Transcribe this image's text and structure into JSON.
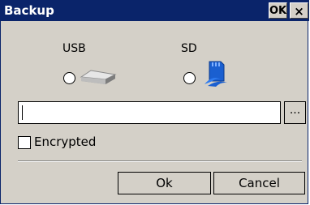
{
  "window": {
    "title": "Backup",
    "ok_label": "OK",
    "close_label": "×"
  },
  "options": {
    "usb": {
      "label": "USB",
      "icon": "usb-drive-icon",
      "selected": false
    },
    "sd": {
      "label": "SD",
      "icon": "sd-card-icon",
      "selected": false
    }
  },
  "path_field": {
    "value": ""
  },
  "browse_label": "...",
  "encrypted": {
    "label": "Encrypted",
    "checked": false
  },
  "buttons": {
    "ok": "Ok",
    "cancel": "Cancel"
  },
  "colors": {
    "titlebar": "#0a246a",
    "face": "#d4d0c8",
    "sd_icon": "#1a5fd0"
  }
}
